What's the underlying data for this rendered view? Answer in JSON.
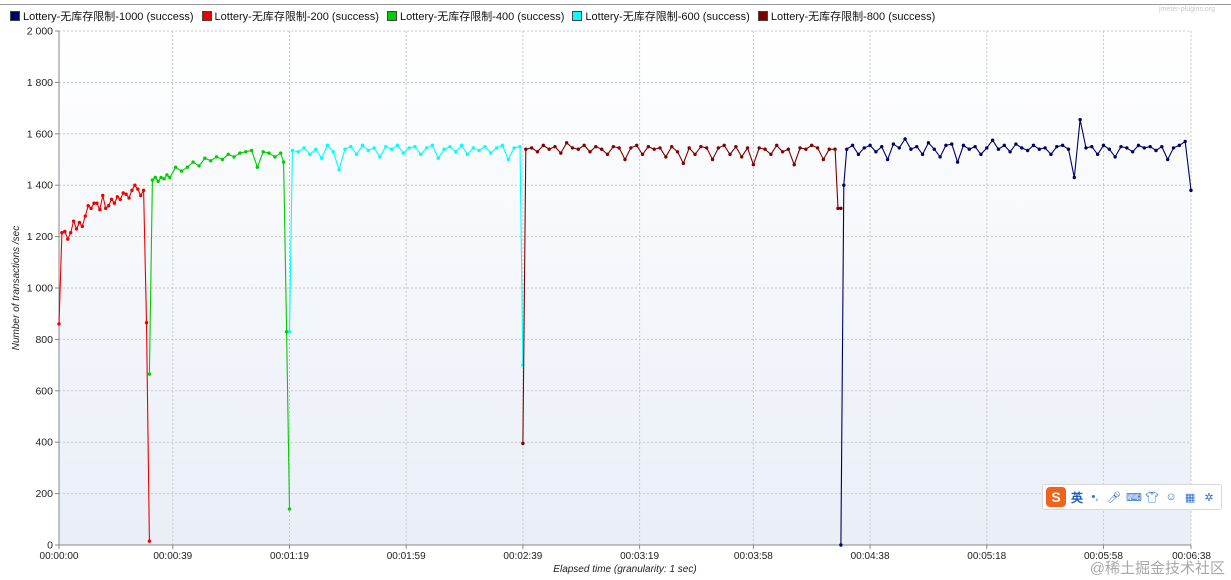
{
  "watermark_top": "jmeter-plugins.org",
  "watermark_bottom": "@稀土掘金技术社区",
  "ime_toolbar": {
    "logo": "S",
    "lang_label": "英",
    "icons": [
      "punctuation-icon",
      "microphone-icon",
      "keyboard-icon",
      "skin-icon",
      "emoji-icon",
      "grid-icon",
      "settings-icon"
    ]
  },
  "chart_data": {
    "type": "line",
    "xlabel": "Elapsed time (granularity: 1 sec)",
    "ylabel": "Number of transactions /sec",
    "ylim": [
      0,
      2000
    ],
    "xlim": [
      0,
      388
    ],
    "grid": true,
    "legend_position": "top-left",
    "y_ticks": [
      0,
      200,
      400,
      600,
      800,
      1000,
      1200,
      1400,
      1600,
      1800,
      2000
    ],
    "y_tick_labels": [
      "0",
      "200",
      "400",
      "600",
      "800",
      "1 000",
      "1 200",
      "1 400",
      "1 600",
      "1 800",
      "2 000"
    ],
    "x_ticks": [
      0,
      39,
      79,
      119,
      159,
      199,
      238,
      278,
      318,
      358,
      388
    ],
    "x_tick_labels": [
      "00:00:00",
      "00:00:39",
      "00:01:19",
      "00:01:59",
      "00:02:39",
      "00:03:19",
      "00:03:58",
      "00:04:38",
      "00:05:18",
      "00:05:58",
      "00:06:38"
    ],
    "series": [
      {
        "name": "Lottery-无库存限制-1000 (success)",
        "color": "#000066",
        "x": [
          268,
          269,
          270,
          272,
          274,
          276,
          278,
          280,
          282,
          284,
          286,
          288,
          290,
          292,
          294,
          296,
          298,
          300,
          302,
          304,
          306,
          308,
          310,
          312,
          314,
          316,
          318,
          320,
          322,
          324,
          326,
          328,
          330,
          332,
          334,
          336,
          338,
          340,
          342,
          344,
          346,
          348,
          350,
          352,
          354,
          356,
          358,
          360,
          362,
          364,
          366,
          368,
          370,
          372,
          374,
          376,
          378,
          380,
          382,
          384,
          386,
          388
        ],
        "y": [
          0,
          1400,
          1540,
          1555,
          1520,
          1545,
          1555,
          1530,
          1550,
          1500,
          1560,
          1545,
          1580,
          1540,
          1550,
          1520,
          1565,
          1540,
          1510,
          1555,
          1560,
          1490,
          1555,
          1540,
          1550,
          1520,
          1545,
          1575,
          1540,
          1555,
          1530,
          1560,
          1545,
          1535,
          1555,
          1540,
          1545,
          1520,
          1550,
          1555,
          1540,
          1430,
          1655,
          1545,
          1550,
          1520,
          1555,
          1540,
          1510,
          1550,
          1545,
          1530,
          1555,
          1545,
          1550,
          1535,
          1550,
          1500,
          1545,
          1555,
          1570,
          1380
        ]
      },
      {
        "name": "Lottery-无库存限制-200 (success)",
        "color": "#ee0000",
        "x": [
          0,
          1,
          2,
          3,
          4,
          5,
          6,
          7,
          8,
          9,
          10,
          11,
          12,
          13,
          14,
          15,
          16,
          17,
          18,
          19,
          20,
          21,
          22,
          23,
          24,
          25,
          26,
          27,
          28,
          29,
          30,
          31
        ],
        "y": [
          860,
          1215,
          1220,
          1190,
          1215,
          1260,
          1230,
          1255,
          1240,
          1280,
          1320,
          1310,
          1330,
          1330,
          1305,
          1360,
          1310,
          1320,
          1345,
          1330,
          1355,
          1345,
          1370,
          1365,
          1350,
          1380,
          1400,
          1385,
          1360,
          1380,
          865,
          15
        ]
      },
      {
        "name": "Lottery-无库存限制-400 (success)",
        "color": "#00cc00",
        "x": [
          31,
          32,
          33,
          34,
          35,
          36,
          37,
          38,
          40,
          42,
          44,
          46,
          48,
          50,
          52,
          54,
          56,
          58,
          60,
          62,
          64,
          66,
          68,
          70,
          72,
          74,
          76,
          77,
          78,
          79
        ],
        "y": [
          665,
          1420,
          1430,
          1415,
          1430,
          1425,
          1440,
          1430,
          1470,
          1455,
          1470,
          1490,
          1475,
          1505,
          1495,
          1510,
          1500,
          1520,
          1510,
          1525,
          1530,
          1535,
          1470,
          1530,
          1525,
          1510,
          1525,
          1490,
          830,
          140
        ]
      },
      {
        "name": "Lottery-无库存限制-600 (success)",
        "color": "#00ffff",
        "x": [
          79,
          80,
          82,
          84,
          86,
          88,
          90,
          92,
          94,
          96,
          98,
          100,
          102,
          104,
          106,
          108,
          110,
          112,
          114,
          116,
          118,
          120,
          122,
          124,
          126,
          128,
          130,
          132,
          134,
          136,
          138,
          140,
          142,
          144,
          146,
          148,
          150,
          152,
          154,
          156,
          158,
          159
        ],
        "y": [
          830,
          1535,
          1530,
          1545,
          1520,
          1540,
          1505,
          1555,
          1530,
          1460,
          1540,
          1550,
          1520,
          1555,
          1535,
          1545,
          1510,
          1550,
          1540,
          1555,
          1525,
          1545,
          1550,
          1520,
          1545,
          1555,
          1505,
          1540,
          1550,
          1530,
          1555,
          1520,
          1545,
          1535,
          1550,
          1525,
          1545,
          1555,
          1500,
          1545,
          1550,
          700
        ]
      },
      {
        "name": "Lottery-无库存限制-800 (success)",
        "color": "#800000",
        "x": [
          159,
          160,
          162,
          164,
          166,
          168,
          170,
          172,
          174,
          176,
          178,
          180,
          182,
          184,
          186,
          188,
          190,
          192,
          194,
          196,
          198,
          200,
          202,
          204,
          206,
          208,
          210,
          212,
          214,
          216,
          218,
          220,
          222,
          224,
          226,
          228,
          230,
          232,
          234,
          236,
          238,
          240,
          242,
          244,
          246,
          248,
          250,
          252,
          254,
          256,
          258,
          260,
          262,
          264,
          266,
          267,
          268
        ],
        "y": [
          395,
          1540,
          1545,
          1530,
          1555,
          1540,
          1550,
          1525,
          1565,
          1545,
          1540,
          1555,
          1530,
          1550,
          1540,
          1520,
          1550,
          1545,
          1500,
          1545,
          1555,
          1520,
          1550,
          1540,
          1545,
          1510,
          1550,
          1530,
          1485,
          1545,
          1520,
          1550,
          1545,
          1500,
          1545,
          1555,
          1520,
          1550,
          1510,
          1545,
          1480,
          1545,
          1540,
          1520,
          1555,
          1530,
          1540,
          1480,
          1545,
          1540,
          1555,
          1545,
          1500,
          1540,
          1540,
          1310,
          1310
        ]
      }
    ]
  }
}
